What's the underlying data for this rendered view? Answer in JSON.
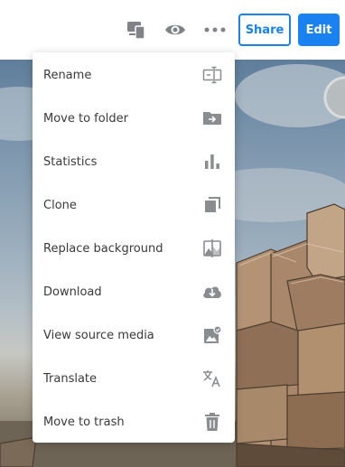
{
  "toolbar": {
    "icons": [
      "devices-icon",
      "preview-eye-icon",
      "more-options-icon"
    ],
    "share_label": "Share",
    "edit_label": "Edit",
    "accent_color": "#1a82f0"
  },
  "menu": {
    "items": [
      {
        "label": "Rename",
        "icon": "rename-icon"
      },
      {
        "label": "Move to folder",
        "icon": "move-folder-icon"
      },
      {
        "label": "Statistics",
        "icon": "bar-chart-icon"
      },
      {
        "label": "Clone",
        "icon": "clone-icon"
      },
      {
        "label": "Replace background",
        "icon": "replace-image-icon"
      },
      {
        "label": "Download",
        "icon": "cloud-download-icon"
      },
      {
        "label": "View source media",
        "icon": "source-media-icon"
      },
      {
        "label": "Translate",
        "icon": "translate-icon"
      },
      {
        "label": "Move to trash",
        "icon": "trash-icon"
      }
    ]
  },
  "background": {
    "icon": "coastal-rocks-photo"
  }
}
